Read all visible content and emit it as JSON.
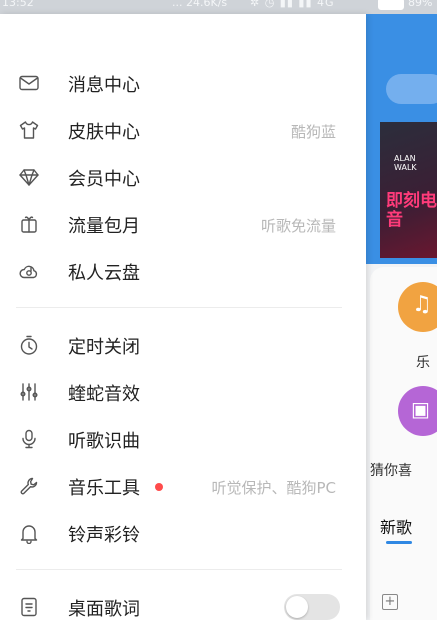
{
  "status_bar": {
    "time": "13:52",
    "net_speed": "... 24.6K/s",
    "network": "4G",
    "battery": "89%"
  },
  "drawer": {
    "group1": [
      {
        "icon": "envelope-icon",
        "label": "消息中心",
        "sub": ""
      },
      {
        "icon": "shirt-icon",
        "label": "皮肤中心",
        "sub": "酷狗蓝"
      },
      {
        "icon": "diamond-icon",
        "label": "会员中心",
        "sub": ""
      },
      {
        "icon": "gift-icon",
        "label": "流量包月",
        "sub": "听歌免流量"
      },
      {
        "icon": "cloud-disk-icon",
        "label": "私人云盘",
        "sub": ""
      }
    ],
    "group2": [
      {
        "icon": "timer-icon",
        "label": "定时关闭",
        "sub": ""
      },
      {
        "icon": "equalizer-icon",
        "label": "蝰蛇音效",
        "sub": ""
      },
      {
        "icon": "mic-icon",
        "label": "听歌识曲",
        "sub": ""
      },
      {
        "icon": "wrench-icon",
        "label": "音乐工具",
        "sub": "听觉保护、酷狗PC",
        "badge_dot": true
      },
      {
        "icon": "bell-icon",
        "label": "铃声彩铃",
        "sub": ""
      }
    ],
    "group3": [
      {
        "icon": "lyrics-icon",
        "label": "桌面歌词",
        "toggle_on": false
      }
    ]
  },
  "background_app": {
    "banner_small": "ALAN WALK",
    "banner_cn": "即刻电音",
    "shortcut1": "乐",
    "shortcut2": "猜你喜",
    "section": "新歌"
  },
  "colors": {
    "accent": "#3a8fe4",
    "badge": "#ff4b4b",
    "sub_text": "#b8b8b8"
  }
}
